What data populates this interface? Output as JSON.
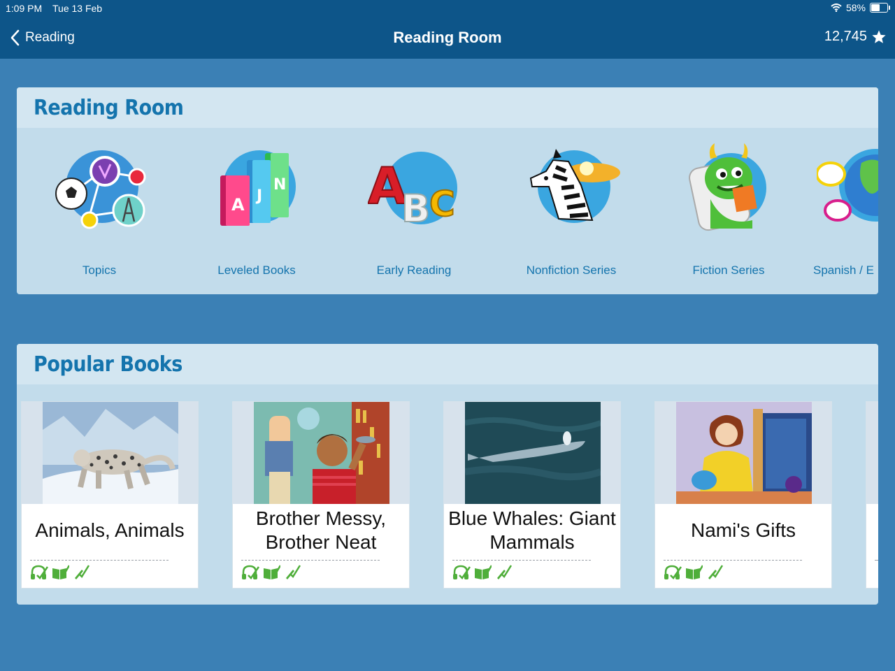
{
  "status_bar": {
    "time": "1:09 PM",
    "date": "Tue 13 Feb",
    "battery_percent": "58%",
    "battery_level": 0.58
  },
  "nav": {
    "back_label": "Reading",
    "title": "Reading Room",
    "points": "12,745"
  },
  "reading_room": {
    "heading": "Reading Room",
    "categories": [
      {
        "label": "Topics",
        "icon": "topics-icon"
      },
      {
        "label": "Leveled Books",
        "icon": "leveled-books-icon"
      },
      {
        "label": "Early Reading",
        "icon": "abc-blocks-icon"
      },
      {
        "label": "Nonfiction Series",
        "icon": "zebra-icon"
      },
      {
        "label": "Fiction Series",
        "icon": "monster-reading-icon"
      },
      {
        "label": "Spanish / E",
        "icon": "globe-speech-icon"
      }
    ]
  },
  "popular_books": {
    "heading": "Popular Books",
    "books": [
      {
        "title": "Animals, Animals",
        "cover": "snow-leopard-photo"
      },
      {
        "title": "Brother Messy, Brother Neat",
        "cover": "boy-bedroom-illustration"
      },
      {
        "title": "Blue Whales: Giant Mammals",
        "cover": "blue-whale-photo"
      },
      {
        "title": "Nami's Gifts",
        "cover": "woman-teapot-illustration"
      }
    ],
    "activity_icons": [
      "listen-icon",
      "read-icon",
      "quiz-icon"
    ]
  },
  "colors": {
    "nav_bg": "#0d5589",
    "page_bg": "#3b80b5",
    "heading": "#1474ad",
    "activity_green": "#4fae3a"
  }
}
